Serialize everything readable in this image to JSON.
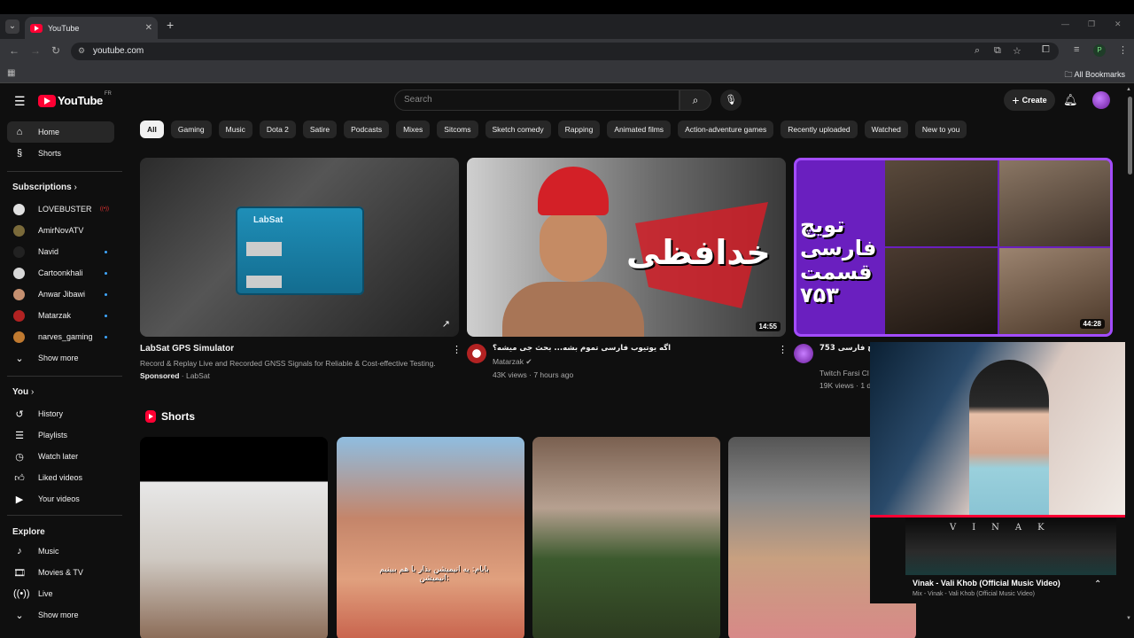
{
  "browser": {
    "tab_title": "YouTube",
    "url": "youtube.com",
    "all_bookmarks": "All Bookmarks",
    "profile_initial": "P"
  },
  "header": {
    "logo_text": "YouTube",
    "country": "FR",
    "search_placeholder": "Search",
    "create_label": "Create"
  },
  "sidebar": {
    "main": [
      {
        "label": "Home",
        "icon": "home-icon"
      },
      {
        "label": "Shorts",
        "icon": "shorts-icon"
      }
    ],
    "subscriptions_heading": "Subscriptions",
    "subscriptions": [
      {
        "label": "LOVEBUSTER",
        "color": "#e0e0e0"
      },
      {
        "label": "AmirNovATV",
        "color": "#7a6a3a"
      },
      {
        "label": "Navid",
        "color": "#222222"
      },
      {
        "label": "Cartoonkhali",
        "color": "#d8d8d8"
      },
      {
        "label": "Anwar Jibawi",
        "color": "#c59070"
      },
      {
        "label": "Matarzak",
        "color": "#b22222"
      },
      {
        "label": "narves_gaming",
        "color": "#c07a30"
      }
    ],
    "show_more": "Show more",
    "you_heading": "You",
    "you_items": [
      {
        "label": "History",
        "icon": "history-icon"
      },
      {
        "label": "Playlists",
        "icon": "playlists-icon"
      },
      {
        "label": "Watch later",
        "icon": "clock-icon"
      },
      {
        "label": "Liked videos",
        "icon": "thumbs-up-icon"
      },
      {
        "label": "Your videos",
        "icon": "video-icon"
      }
    ],
    "explore_heading": "Explore",
    "explore_items": [
      {
        "label": "Music",
        "icon": "music-icon"
      },
      {
        "label": "Movies & TV",
        "icon": "film-icon"
      },
      {
        "label": "Live",
        "icon": "live-icon"
      }
    ],
    "show_more_2": "Show more"
  },
  "chips": [
    "All",
    "Gaming",
    "Music",
    "Dota 2",
    "Satire",
    "Podcasts",
    "Mixes",
    "Sitcoms",
    "Sketch comedy",
    "Rapping",
    "Animated films",
    "Action-adventure games",
    "Recently uploaded",
    "Watched",
    "New to you"
  ],
  "videos": [
    {
      "title": "LabSat GPS Simulator",
      "description": "Record & Replay Live and Recorded GNSS Signals for Reliable & Cost-effective Testing.",
      "sponsored": "Sponsored",
      "channel": "LabSat",
      "thumb_text": "LabSat"
    },
    {
      "title": "اگه یوتیوب فارسی تموم بشه... بحث جی میشه؟",
      "channel": "Matarzak",
      "views": "43K views",
      "age": "7 hours ago",
      "duration": "14:55",
      "thumb_text": "خدافظی"
    },
    {
      "title": "توییچ فارسی 753",
      "channel": "Twitch Farsi Cl",
      "views": "19K views",
      "age": "1 d",
      "duration": "44:28",
      "thumb_text": "تویچ فارسی قسمت ۷۵۳"
    }
  ],
  "shorts": {
    "heading": "Shorts",
    "caption_2": "بابام: یه انیمیشن بذار با هم ببینیم انیمیشن:"
  },
  "miniplayer": {
    "art_text": "VINAK",
    "title": "Vinak - Vali Khob (Official Music Video)",
    "subtitle": "Mix - Vinak - Vali Khob (Official Music Video)"
  }
}
